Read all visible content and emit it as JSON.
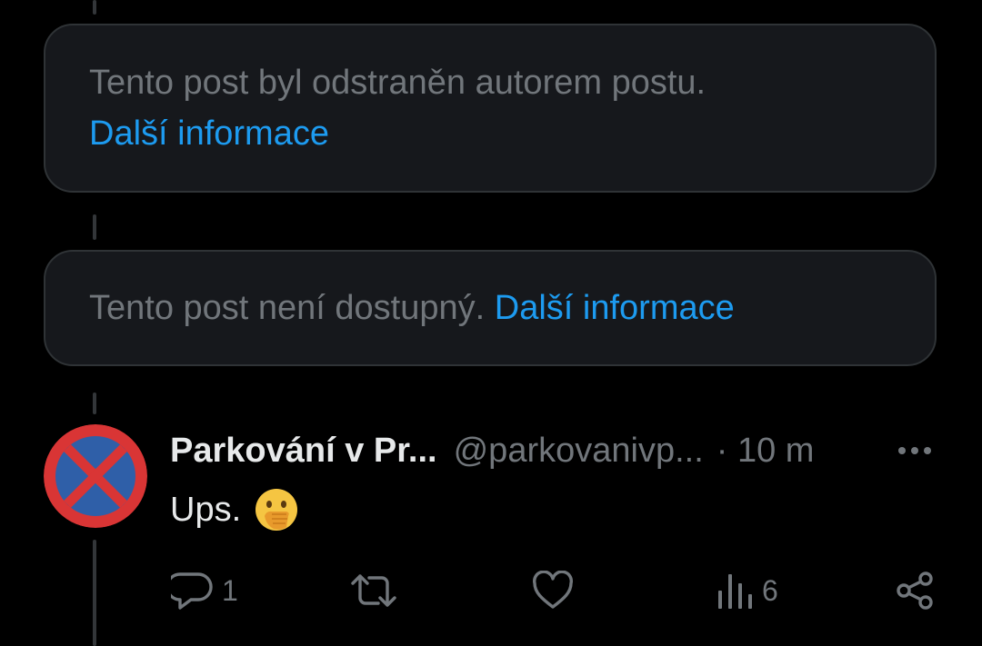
{
  "deleted_notice": {
    "text": "Tento post byl odstraněn autorem postu.",
    "link": "Další informace"
  },
  "unavailable_notice": {
    "text": "Tento post není dostupný.",
    "link": "Další informace"
  },
  "post": {
    "author_name": "Parkování v Pr...",
    "author_handle": "@parkovanivp...",
    "time": "· 10 m",
    "text": "Ups.",
    "emoji": "face-with-hand-over-mouth-emoji",
    "actions": {
      "replies": "1",
      "reposts": "",
      "likes": "",
      "views": "6"
    }
  },
  "colors": {
    "background": "#000000",
    "card_background": "#16181c",
    "card_border": "#2f3336",
    "muted_text": "#71767b",
    "link": "#1d9bf0",
    "primary_text": "#e7e9ea",
    "avatar_red": "#d93535",
    "avatar_blue": "#2f5fa8"
  },
  "icons": {
    "more": "more-dots-icon",
    "reply": "reply-bubble-icon",
    "repost": "repost-arrows-icon",
    "like": "heart-icon",
    "views": "views-bars-icon",
    "share": "share-icon"
  }
}
